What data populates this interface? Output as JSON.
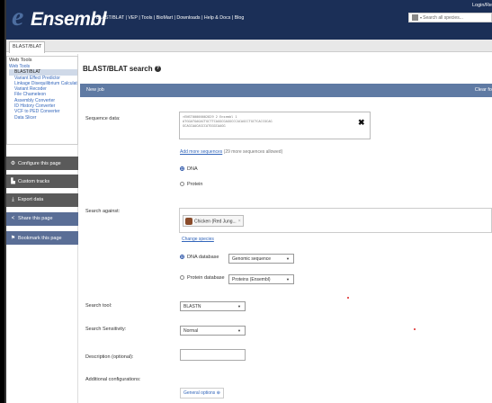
{
  "header": {
    "logo_e": "e",
    "logo_text": "Ensembl",
    "nav": [
      "BLAST/BLAT",
      "VEP",
      "Tools",
      "BioMart",
      "Downloads",
      "Help & Docs",
      "Blog"
    ],
    "login": "Login/Re",
    "search_placeholder": "Search all species..."
  },
  "tabs": {
    "current": "BLAST/BLAT"
  },
  "sidebar": {
    "tools_heading": "Web Tools",
    "tools": [
      {
        "label": "Web Tools",
        "level": 1,
        "active": false
      },
      {
        "label": "BLAST/BLAT",
        "level": 2,
        "active": true
      },
      {
        "label": "Variant Effect Predictor",
        "level": 2,
        "active": false
      },
      {
        "label": "Linkage Disequilibrium Calculator",
        "level": 2,
        "active": false
      },
      {
        "label": "Variant Recoder",
        "level": 2,
        "active": false
      },
      {
        "label": "File Chameleon",
        "level": 2,
        "active": false
      },
      {
        "label": "Assembly Converter",
        "level": 2,
        "active": false
      },
      {
        "label": "ID History Converter",
        "level": 2,
        "active": false
      },
      {
        "label": "VCF to PED Converter",
        "level": 2,
        "active": false
      },
      {
        "label": "Data Slicer",
        "level": 2,
        "active": false
      }
    ],
    "buttons": [
      {
        "label": "Configure this page",
        "icon": "gear-icon",
        "glyph": "⚙"
      },
      {
        "label": "Custom tracks",
        "icon": "tracks-icon",
        "glyph": "▙"
      },
      {
        "label": "Export data",
        "icon": "export-icon",
        "glyph": "⤓"
      },
      {
        "label": "Share this page",
        "icon": "share-icon",
        "glyph": "<"
      },
      {
        "label": "Bookmark this page",
        "icon": "bookmark-icon",
        "glyph": "⚑"
      }
    ]
  },
  "main": {
    "title": "BLAST/BLAT search",
    "help_glyph": "?",
    "new_job": "New job",
    "clear_form": "Clear fo",
    "labels": {
      "sequence": "Sequence data:",
      "search_against": "Search against:",
      "search_tool": "Search tool:",
      "sensitivity": "Search Sensitivity:",
      "description": "Description (optional):",
      "additional": "Additional configurations:"
    },
    "sequence_text": ">ENST00000002829 2 Ensembl 1\nATGGATGAGACTGCTTCAGGCGAGGCCCACAGCCTGCTCACCGCAG\nGCAGCAACAGCCATGGGCAAGG",
    "close_glyph": "✖",
    "add_sequences": "Add more sequences",
    "add_sequences_note": "(29 more sequences allowed)",
    "seq_type": [
      {
        "label": "DNA",
        "checked": true
      },
      {
        "label": "Protein",
        "checked": false
      }
    ],
    "species_tag": "Chicken (Red Jung...",
    "species_remove": "×",
    "change_species": "Change species",
    "db_dna_label": "DNA database",
    "db_dna_value": "Genomic sequence",
    "db_protein_label": "Protein database",
    "db_protein_value": "Proteins (Ensembl)",
    "search_tool_value": "BLASTN",
    "sensitivity_value": "Normal",
    "general_options": "General options ⊕",
    "caret": "▼"
  }
}
